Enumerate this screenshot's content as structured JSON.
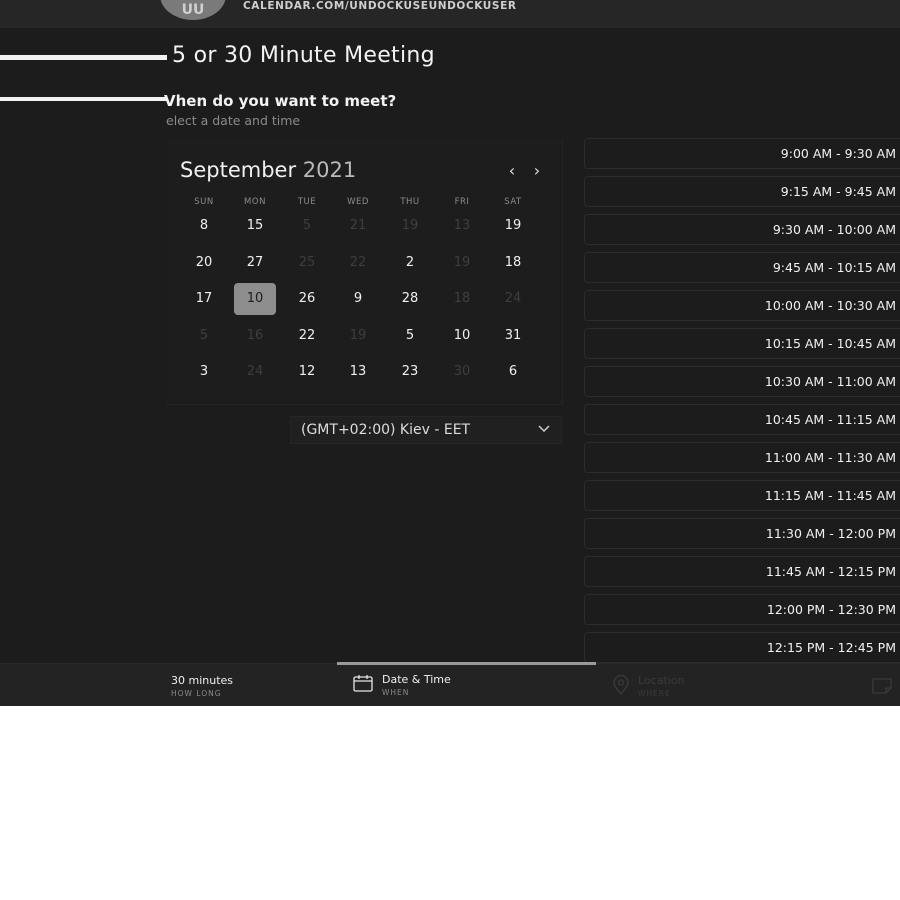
{
  "header": {
    "avatar_initials": "UU",
    "booking_url": "CALENDAR.COM/UNDOCKUSEUNDOCKUSER"
  },
  "event": {
    "title": "5 or 30 Minute Meeting",
    "question": "Vhen do you want to meet?",
    "hint": "elect a date and time"
  },
  "calendar": {
    "month": "September",
    "year": "2021",
    "prev_label": "‹",
    "next_label": "›",
    "weekdays": [
      "SUN",
      "MON",
      "TUE",
      "WED",
      "THU",
      "FRI",
      "SAT"
    ],
    "weeks": [
      [
        {
          "d": "8",
          "on": true
        },
        {
          "d": "15",
          "on": true
        },
        {
          "d": "5",
          "on": false
        },
        {
          "d": "21",
          "on": false
        },
        {
          "d": "19",
          "on": false
        },
        {
          "d": "13",
          "on": false
        },
        {
          "d": "19",
          "on": true
        }
      ],
      [
        {
          "d": "20",
          "on": true
        },
        {
          "d": "27",
          "on": true
        },
        {
          "d": "25",
          "on": false
        },
        {
          "d": "22",
          "on": false
        },
        {
          "d": "2",
          "on": true
        },
        {
          "d": "19",
          "on": false
        },
        {
          "d": "18",
          "on": true
        }
      ],
      [
        {
          "d": "17",
          "on": true
        },
        {
          "d": "10",
          "on": true,
          "selected": true
        },
        {
          "d": "26",
          "on": true
        },
        {
          "d": "9",
          "on": true
        },
        {
          "d": "28",
          "on": true
        },
        {
          "d": "18",
          "on": false
        },
        {
          "d": "24",
          "on": false
        }
      ],
      [
        {
          "d": "5",
          "on": false
        },
        {
          "d": "16",
          "on": false
        },
        {
          "d": "22",
          "on": true
        },
        {
          "d": "19",
          "on": false
        },
        {
          "d": "5",
          "on": true
        },
        {
          "d": "10",
          "on": true
        },
        {
          "d": "31",
          "on": true
        }
      ],
      [
        {
          "d": "3",
          "on": true
        },
        {
          "d": "24",
          "on": false
        },
        {
          "d": "12",
          "on": true
        },
        {
          "d": "13",
          "on": true
        },
        {
          "d": "23",
          "on": true
        },
        {
          "d": "30",
          "on": false
        },
        {
          "d": "6",
          "on": true
        }
      ]
    ]
  },
  "timezone": {
    "value": "(GMT+02:00) Kiev - EET",
    "icon": "chevron-down-icon"
  },
  "slots": [
    "9:00 AM - 9:30 AM",
    "9:15 AM - 9:45 AM",
    "9:30 AM - 10:00 AM",
    "9:45 AM - 10:15 AM",
    "10:00 AM - 10:30 AM",
    "10:15 AM - 10:45 AM",
    "10:30 AM - 11:00 AM",
    "10:45 AM - 11:15 AM",
    "11:00 AM - 11:30 AM",
    "11:15 AM - 11:45 AM",
    "11:30 AM - 12:00 PM",
    "11:45 AM - 12:15 PM",
    "12:00 PM - 12:30 PM",
    "12:15 PM - 12:45 PM"
  ],
  "footer": {
    "duration": {
      "label": "30 minutes",
      "sub": "HOW LONG"
    },
    "datetime": {
      "label": "Date & Time",
      "sub": "WHEN",
      "icon": "calendar-icon"
    },
    "location": {
      "label": "Location",
      "sub": "WHERE",
      "icon": "location-pin-icon"
    },
    "notes": {
      "icon": "note-icon"
    }
  },
  "colors": {
    "background": "#1c1c1c",
    "selected_day": "#8d8d8d",
    "text": "#f0f0f0",
    "muted": "#8a8a8a"
  }
}
